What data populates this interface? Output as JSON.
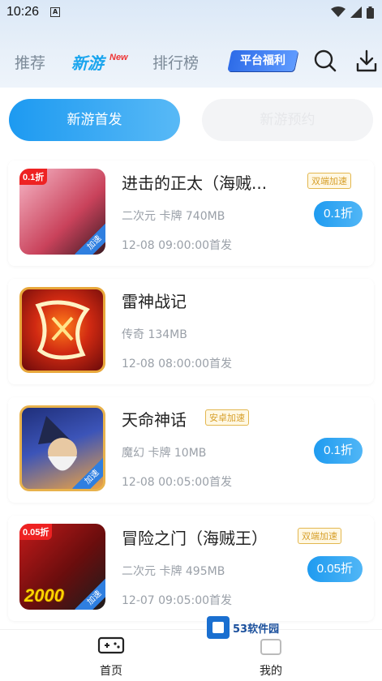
{
  "status": {
    "time": "10:26",
    "notif_icon": "A"
  },
  "nav": {
    "tabs": [
      {
        "label": "推荐"
      },
      {
        "label": "新游"
      },
      {
        "label": "排行榜"
      }
    ],
    "new_tag": "New",
    "platform_badge": "平台福利",
    "search_icon": "search-icon",
    "download_icon": "download-icon"
  },
  "segment": {
    "left": "新游首发",
    "right": "新游预约"
  },
  "games": [
    {
      "title": "进击的正太（海贼...",
      "badge": "双端加速",
      "meta": "二次元 卡牌 740MB",
      "date": "12-08 09:00:00首发",
      "discount": "0.1折",
      "thumb_tag": "0.1折",
      "speed_tag": "加速",
      "colors": [
        "#f7b7c7",
        "#c9425b"
      ]
    },
    {
      "title": "雷神战记",
      "badge": "",
      "meta": "传奇 134MB",
      "date": "12-08 08:00:00首发",
      "discount": "",
      "thumb_tag": "",
      "speed_tag": "",
      "colors": [
        "#b5141b",
        "#ff7d1a"
      ]
    },
    {
      "title": "天命神话",
      "badge": "安卓加速",
      "meta": "魔幻 卡牌 10MB",
      "date": "12-08 00:05:00首发",
      "discount": "0.1折",
      "thumb_tag": "",
      "speed_tag": "加速",
      "colors": [
        "#1f2f7a",
        "#f0a441"
      ]
    },
    {
      "title": "冒险之门（海贼王）",
      "badge": "双端加速",
      "meta": "二次元 卡牌 495MB",
      "date": "12-07 09:05:00首发",
      "discount": "0.05折",
      "thumb_tag": "0.05折",
      "speed_tag": "加速",
      "colors": [
        "#c21a1a",
        "#1d1d1d"
      ],
      "thumb_extra": "2000"
    }
  ],
  "watermark": "53软件园",
  "bottom": {
    "home": "首页",
    "mine": "我的"
  },
  "colors": {
    "accent": "#1aa5ee",
    "badge": "#d7a02c"
  }
}
